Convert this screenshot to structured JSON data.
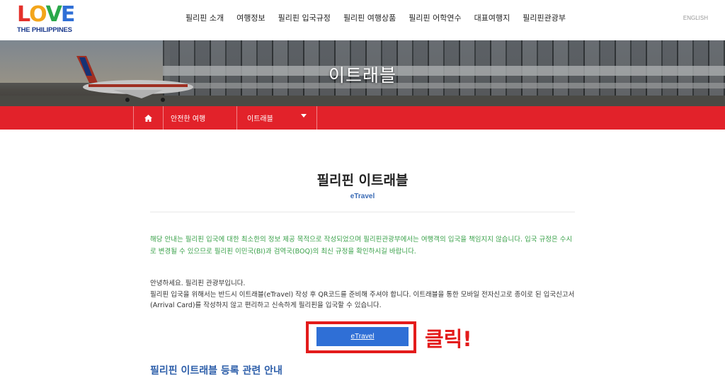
{
  "brand": {
    "logo_letters": [
      "L",
      "O",
      "V",
      "E"
    ],
    "logo_colors": [
      "#e4312b",
      "#f3a51b",
      "#2aa84a",
      "#2f6fd6"
    ],
    "logo_sub": "THE PHILIPPINES"
  },
  "nav": {
    "items": [
      "필리핀 소개",
      "여행정보",
      "필리핀 입국규정",
      "필리핀 여행상품",
      "필리핀 어학연수",
      "대표여행지",
      "필리핀관광부"
    ],
    "language": "ENGLISH"
  },
  "hero": {
    "title": "이트래블"
  },
  "breadcrumb": {
    "home_icon": "home-icon",
    "level1": "안전한 여행",
    "level2": "이트래블"
  },
  "content": {
    "title": "필리핀 이트래블",
    "subtitle": "eTravel",
    "notice": "해당 안내는 필리핀 입국에 대한 최소한의 정보 제공 목적으로 작성되었으며 필리핀관광부에서는 여행객의 입국을 책임지지 않습니다. 입국 규정은 수시로 변경될 수 있으므로 필리핀 이민국(BI)과 검역국(BOQ)의 최신 규정을 확인하시길 바랍니다.",
    "greeting": "안녕하세요. 필리핀 관광부입니다.",
    "body": "필리핀 입국을 위해서는 반드시 이트래블(eTravel) 작성 후 QR코드를 준비해 주셔야 합니다. 이트래블을 통한 모바일 전자신고로 종이로 된 입국신고서(Arrival Card)를 작성하지 않고 편리하고 신속하게 필리핀을 입국할 수 있습니다.",
    "button_label": "eTravel",
    "click_label": "클릭!",
    "section_heading": "필리핀 이트래블 등록 관련 안내"
  },
  "colors": {
    "accent_red": "#e2222a",
    "button_blue": "#2f6fd6",
    "notice_green": "#3aa14a",
    "heading_blue": "#2e5faa"
  }
}
